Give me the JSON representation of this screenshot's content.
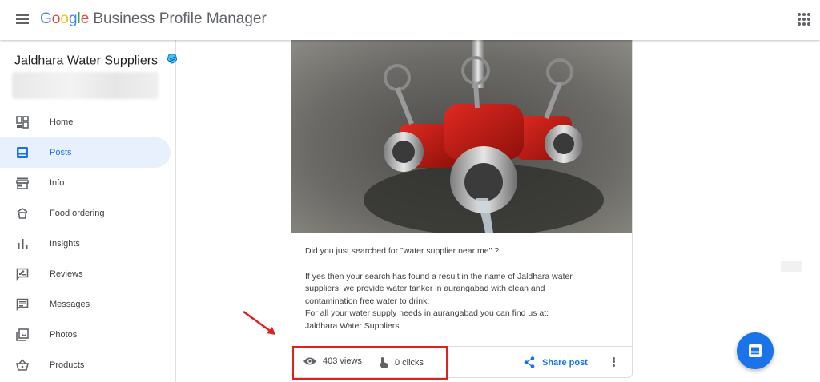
{
  "header": {
    "logo_letters": [
      "G",
      "o",
      "o",
      "g",
      "l",
      "e"
    ],
    "logo_colors": [
      "#4285F4",
      "#EA4335",
      "#FBBC05",
      "#4285F4",
      "#34A853",
      "#EA4335"
    ],
    "product_name": "Business Profile Manager",
    "menu_icon": "hamburger-menu-icon",
    "apps_icon": "apps-grid-icon"
  },
  "sidebar": {
    "business_name": "Jaldhara Water Suppliers",
    "business_icon": "verified-pin-icon",
    "items": [
      {
        "label": "Home",
        "icon": "dashboard-icon",
        "active": false
      },
      {
        "label": "Posts",
        "icon": "posts-icon",
        "active": true
      },
      {
        "label": "Info",
        "icon": "storefront-icon",
        "active": false
      },
      {
        "label": "Food ordering",
        "icon": "food-ordering-icon",
        "active": false
      },
      {
        "label": "Insights",
        "icon": "bar-chart-icon",
        "active": false
      },
      {
        "label": "Reviews",
        "icon": "rate-review-icon",
        "active": false
      },
      {
        "label": "Messages",
        "icon": "message-icon",
        "active": false
      },
      {
        "label": "Photos",
        "icon": "photo-library-icon",
        "active": false
      },
      {
        "label": "Products",
        "icon": "shopping-basket-icon",
        "active": false
      }
    ]
  },
  "post": {
    "image_subject": "red fire hydrant valves with water flowing",
    "text": {
      "line1": "Did you just searched for \"water supplier near me\" ?",
      "para2_line1": "If yes then your search has found a result in the name of Jaldhara water",
      "para2_line2": "suppliers. we provide water tanker in aurangabad with clean and",
      "para2_line3": "contamination free water to drink.",
      "para2_line4": "For all your water supply needs in aurangabad you can find us at:",
      "para2_line5": "Jaldhara Water Suppliers"
    },
    "views_label": "403 views",
    "clicks_label": "0 clicks",
    "share_label": "Share post"
  },
  "colors": {
    "accent": "#1a73e8",
    "active_bg": "#e8f0fe",
    "highlight": "#e0201b"
  },
  "fab_icon": "create-post-icon"
}
